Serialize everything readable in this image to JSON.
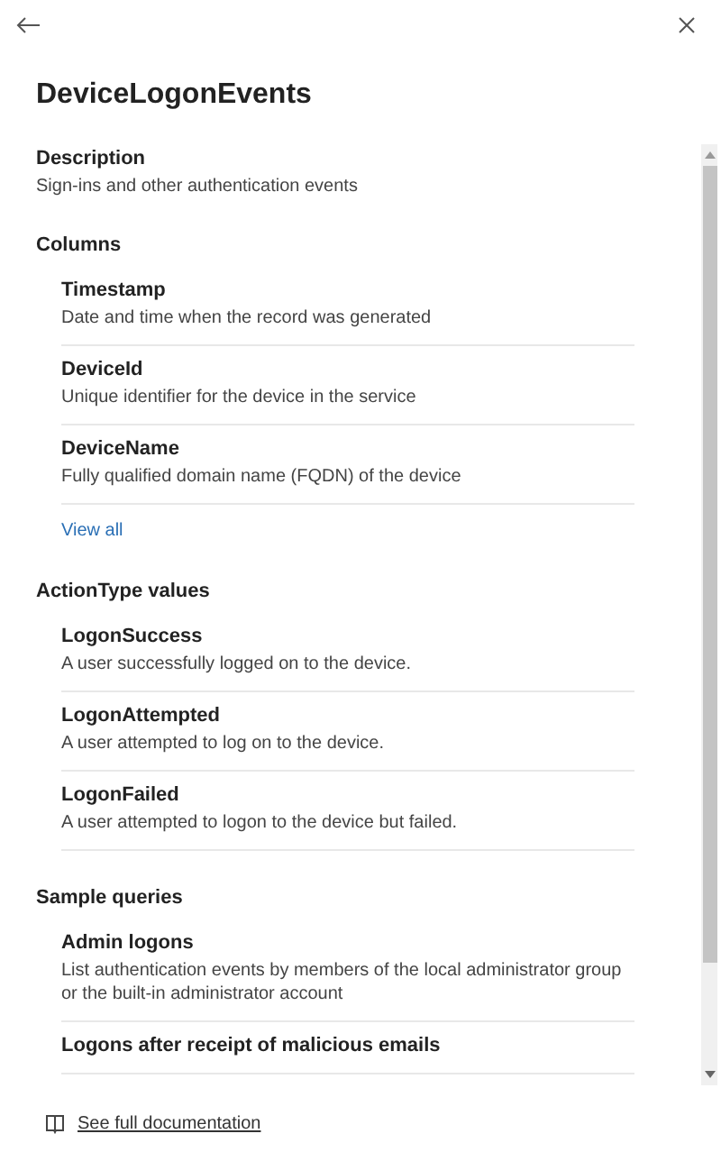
{
  "title": "DeviceLogonEvents",
  "description": {
    "heading": "Description",
    "text": "Sign-ins and other authentication events"
  },
  "columns": {
    "heading": "Columns",
    "items": [
      {
        "name": "Timestamp",
        "text": "Date and time when the record was generated"
      },
      {
        "name": "DeviceId",
        "text": "Unique identifier for the device in the service"
      },
      {
        "name": "DeviceName",
        "text": "Fully qualified domain name (FQDN) of the device"
      }
    ],
    "link": "View all"
  },
  "action_types": {
    "heading": "ActionType values",
    "items": [
      {
        "name": "LogonSuccess",
        "text": "A user successfully logged on to the device."
      },
      {
        "name": "LogonAttempted",
        "text": "A user attempted to log on to the device."
      },
      {
        "name": "LogonFailed",
        "text": "A user attempted to logon to the device but failed."
      }
    ]
  },
  "sample_queries": {
    "heading": "Sample queries",
    "items": [
      {
        "name": "Admin logons",
        "text": "List authentication events by members of the local administrator group or the built-in administrator account"
      },
      {
        "name": "Logons after receipt of malicious emails"
      }
    ]
  },
  "footer_link": "See full documentation"
}
